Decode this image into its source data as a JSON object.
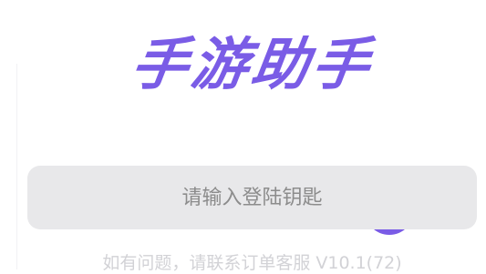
{
  "app": {
    "title": "手游助手"
  },
  "login": {
    "key_placeholder": "请输入登陆钥匙",
    "key_value": ""
  },
  "footer": {
    "note": "如有问题，请联系订单客服 V10.1(72)"
  },
  "colors": {
    "accent": "#7a5ce6",
    "input_bg": "#e8e8ea",
    "placeholder": "#8c8c8c",
    "footer_text": "#d2d2d6"
  }
}
